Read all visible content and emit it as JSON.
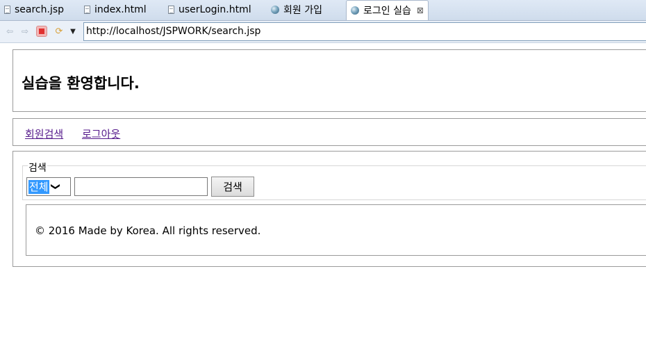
{
  "tabs": [
    {
      "label": "search.jsp",
      "icon": "file-icon",
      "active": false
    },
    {
      "label": "index.html",
      "icon": "file-icon",
      "active": false
    },
    {
      "label": "userLogin.html",
      "icon": "file-icon",
      "active": false
    },
    {
      "label": "회원 가입",
      "icon": "globe-icon",
      "active": false
    },
    {
      "label": "로그인 실습",
      "icon": "globe-icon",
      "active": true,
      "close": "⊠"
    }
  ],
  "toolbar": {
    "back": "⇦",
    "forward": "⇨",
    "refresh": "⟳",
    "menu": "▼",
    "url": "http://localhost/JSPWORK/search.jsp"
  },
  "page": {
    "heading": "실습을 환영합니다.",
    "nav": [
      "회원검색",
      "로그아웃"
    ],
    "search": {
      "legend": "검색",
      "select_value": "전체",
      "input_value": "",
      "button_label": "검색"
    },
    "footer": "© 2016 Made by Korea. All rights reserved."
  },
  "colors": {
    "link": "#551a8b",
    "selection": "#3399ff",
    "border": "#9a9a9a"
  }
}
